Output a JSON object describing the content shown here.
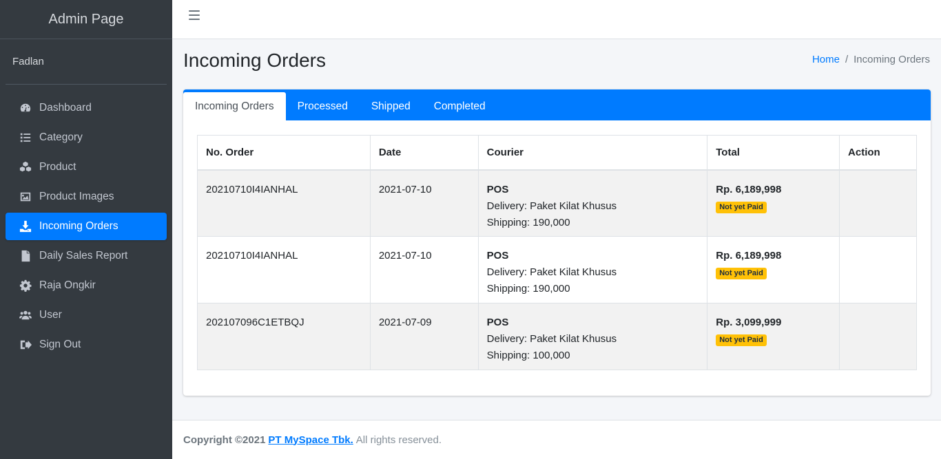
{
  "sidebar": {
    "brand": "Admin Page",
    "user": "Fadlan",
    "items": [
      {
        "label": "Dashboard",
        "icon": "dashboard-icon"
      },
      {
        "label": "Category",
        "icon": "list-icon"
      },
      {
        "label": "Product",
        "icon": "cubes-icon"
      },
      {
        "label": "Product Images",
        "icon": "image-icon"
      },
      {
        "label": "Incoming Orders",
        "icon": "download-icon",
        "active": true
      },
      {
        "label": "Daily Sales Report",
        "icon": "file-icon"
      },
      {
        "label": "Raja Ongkir",
        "icon": "gear-icon"
      },
      {
        "label": "User",
        "icon": "users-icon"
      },
      {
        "label": "Sign Out",
        "icon": "sign-out-icon"
      }
    ]
  },
  "header": {
    "title": "Incoming Orders",
    "breadcrumb": {
      "home": "Home",
      "separator": "/",
      "current": "Incoming Orders"
    }
  },
  "tabs": [
    {
      "label": "Incoming Orders",
      "active": true
    },
    {
      "label": "Processed"
    },
    {
      "label": "Shipped"
    },
    {
      "label": "Completed"
    }
  ],
  "table": {
    "columns": [
      "No. Order",
      "Date",
      "Courier",
      "Total",
      "Action"
    ],
    "rows": [
      {
        "order": "20210710I4IANHAL",
        "date": "2021-07-10",
        "courier": "POS",
        "delivery": "Delivery: Paket Kilat Khusus",
        "shipping": "Shipping: 190,000",
        "total": "Rp. 6,189,998",
        "status": "Not yet Paid"
      },
      {
        "order": "20210710I4IANHAL",
        "date": "2021-07-10",
        "courier": "POS",
        "delivery": "Delivery: Paket Kilat Khusus",
        "shipping": "Shipping: 190,000",
        "total": "Rp. 6,189,998",
        "status": "Not yet Paid"
      },
      {
        "order": "202107096C1ETBQJ",
        "date": "2021-07-09",
        "courier": "POS",
        "delivery": "Delivery: Paket Kilat Khusus",
        "shipping": "Shipping: 100,000",
        "total": "Rp. 3,099,999",
        "status": "Not yet Paid"
      }
    ]
  },
  "footer": {
    "copyright": "Copyright ©2021",
    "company": "PT MySpace Tbk.",
    "rights": "All rights reserved."
  },
  "colors": {
    "accent": "#007bff",
    "sidebar": "#343a40",
    "badge": "#ffc107"
  }
}
